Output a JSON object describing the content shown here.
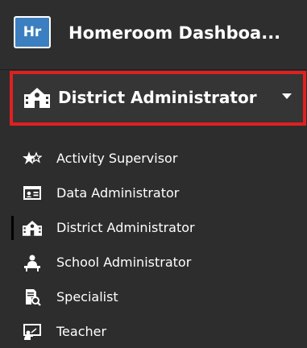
{
  "app": {
    "logo_text": "Hr",
    "title": "Homeroom Dashboa...",
    "logo_color": "#3c7fc0"
  },
  "role_selector": {
    "selected_label": "District Administrator",
    "highlight_color": "#e02020",
    "icon": "school-building-icon",
    "dropdown_icon": "caret-down-icon"
  },
  "roles": [
    {
      "label": "Activity Supervisor",
      "icon": "stars-icon",
      "active": false
    },
    {
      "label": "Data Administrator",
      "icon": "id-card-icon",
      "active": false
    },
    {
      "label": "District Administrator",
      "icon": "school-building-icon",
      "active": true
    },
    {
      "label": "School Administrator",
      "icon": "person-at-desk-icon",
      "active": false
    },
    {
      "label": "Specialist",
      "icon": "document-search-icon",
      "active": false
    },
    {
      "label": "Teacher",
      "icon": "chalkboard-teacher-icon",
      "active": false
    }
  ]
}
